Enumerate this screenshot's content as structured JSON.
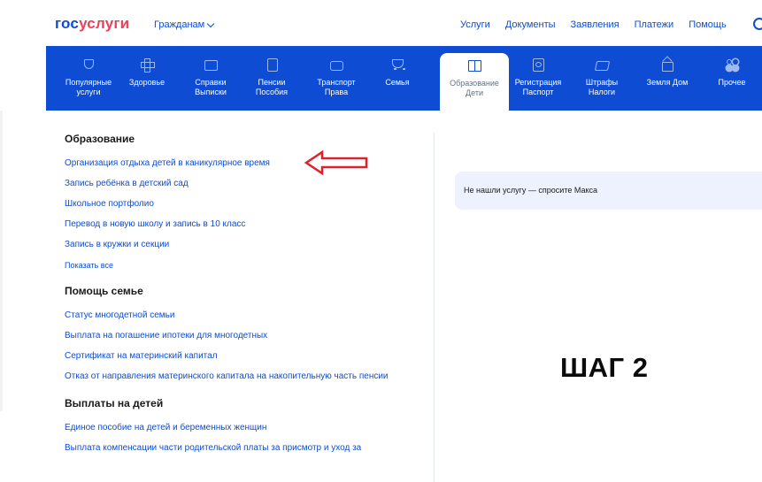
{
  "header": {
    "logo_part1": "гос",
    "logo_part2": "услуги",
    "audience": "Гражданам",
    "nav": [
      "Услуги",
      "Документы",
      "Заявления",
      "Платежи",
      "Помощь"
    ]
  },
  "categories": [
    {
      "line1": "Популярные",
      "line2": "услуги",
      "icon": "heart-icon",
      "active": false
    },
    {
      "line1": "Здоровье",
      "line2": "",
      "icon": "medical-cross-icon",
      "active": false
    },
    {
      "line1": "Справки",
      "line2": "Выписки",
      "icon": "folder-icon",
      "active": false
    },
    {
      "line1": "Пенсии",
      "line2": "Пособия",
      "icon": "document-icon",
      "active": false
    },
    {
      "line1": "Транспорт",
      "line2": "Права",
      "icon": "car-icon",
      "active": false
    },
    {
      "line1": "Семья",
      "line2": "",
      "icon": "stroller-icon",
      "active": false
    },
    {
      "line1": "Образование",
      "line2": "Дети",
      "icon": "book-icon",
      "active": true
    },
    {
      "line1": "Регистрация",
      "line2": "Паспорт",
      "icon": "passport-icon",
      "active": false
    },
    {
      "line1": "Штрафы",
      "line2": "Налоги",
      "icon": "camera-icon",
      "active": false
    },
    {
      "line1": "Земля Дом",
      "line2": "",
      "icon": "house-icon",
      "active": false
    },
    {
      "line1": "Прочее",
      "line2": "",
      "icon": "grid-icon",
      "active": false
    }
  ],
  "sections": {
    "education": {
      "title": "Образование",
      "links": [
        "Организация отдыха детей в каникулярное время",
        "Запись ребёнка в детский сад",
        "Школьное портфолио",
        "Перевод в новую школу и запись в 10 класс",
        "Запись в кружки и секции"
      ],
      "show_all": "Показать все"
    },
    "family_help": {
      "title": "Помощь семье",
      "links": [
        "Статус многодетной семьи",
        "Выплата на погашение ипотеки для многодетных",
        "Сертификат на материнский капитал",
        "Отказ от направления материнского капитала на накопительную часть пенсии"
      ]
    },
    "child_payments": {
      "title": "Выплаты на детей",
      "links": [
        "Единое пособие на детей и беременных женщин",
        "Выплата компенсации части родительской платы за присмотр и уход за"
      ]
    }
  },
  "ask_box": "Не нашли услугу — спросите Макса",
  "step_label": "ШАГ 2",
  "colors": {
    "brand_blue": "#0d4cd3",
    "brand_red": "#ee3f58",
    "arrow_red": "#e0202a",
    "ask_bg": "#edf2fe"
  }
}
